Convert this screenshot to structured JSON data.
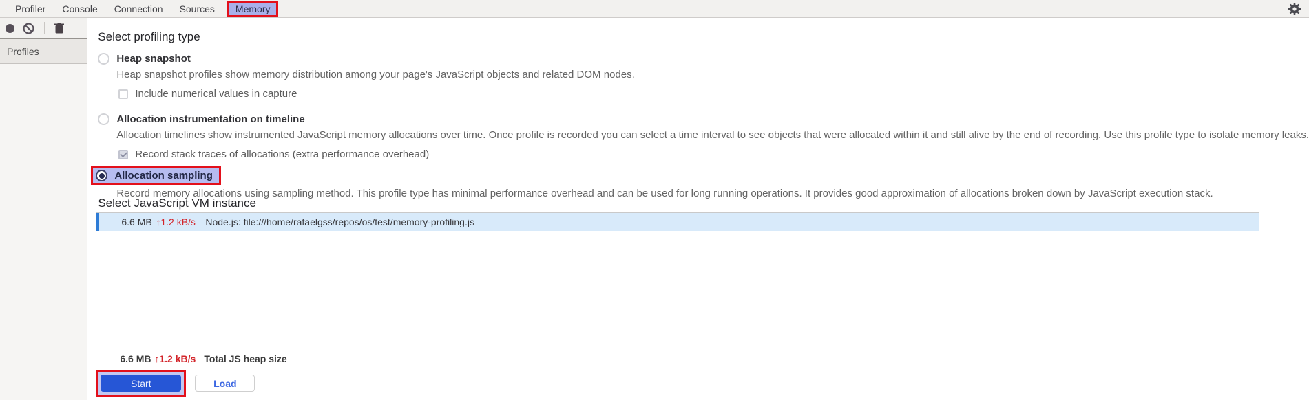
{
  "tabbar": {
    "tabs": [
      {
        "label": "Profiler",
        "active": false
      },
      {
        "label": "Console",
        "active": false
      },
      {
        "label": "Connection",
        "active": false
      },
      {
        "label": "Sources",
        "active": false
      },
      {
        "label": "Memory",
        "active": true,
        "annotated": true
      }
    ],
    "icons": [
      {
        "name": "gear-icon"
      }
    ]
  },
  "toolbar": {
    "icons": [
      {
        "name": "record-icon"
      },
      {
        "name": "clear-icon"
      },
      {
        "name": "delete-icon"
      }
    ]
  },
  "sidebar": {
    "header": "Profiles"
  },
  "profiling": {
    "heading": "Select profiling type",
    "options": [
      {
        "label": "Heap snapshot",
        "selected": false,
        "description": "Heap snapshot profiles show memory distribution among your page's JavaScript objects and related DOM nodes.",
        "checkbox": {
          "label": "Include numerical values in capture",
          "checked": false
        }
      },
      {
        "label": "Allocation instrumentation on timeline",
        "selected": false,
        "description": "Allocation timelines show instrumented JavaScript memory allocations over time. Once profile is recorded you can select a time interval to see objects that were allocated within it and still alive by the end of recording. Use this profile type to isolate memory leaks.",
        "checkbox": {
          "label": "Record stack traces of allocations (extra performance overhead)",
          "checked": true,
          "disabled": true
        }
      },
      {
        "label": "Allocation sampling",
        "selected": true,
        "annotated": true,
        "description": "Record memory allocations using sampling method. This profile type has minimal performance overhead and can be used for long running operations. It provides good approximation of allocations broken down by JavaScript execution stack."
      }
    ]
  },
  "vm": {
    "heading": "Select JavaScript VM instance",
    "instances": [
      {
        "size": "6.6 MB",
        "rate": "↑1.2 kB/s",
        "name": "Node.js: file:///home/rafaelgss/repos/os/test/memory-profiling.js",
        "selected": true
      }
    ],
    "footer": {
      "size": "6.6 MB",
      "rate": "↑1.2 kB/s",
      "label": "Total JS heap size"
    }
  },
  "actions": {
    "start_label": "Start",
    "load_label": "Load"
  },
  "colors": {
    "annotation_red": "#e3101b",
    "active_tab_purple": "#a9b0e9",
    "sampling_highlight_purple": "#b6bcf0",
    "selected_row_blue": "#d8eafa",
    "row_accent_blue": "#2e7cd6",
    "primary_button_blue": "#2656d6",
    "rate_red": "#d3242a"
  }
}
